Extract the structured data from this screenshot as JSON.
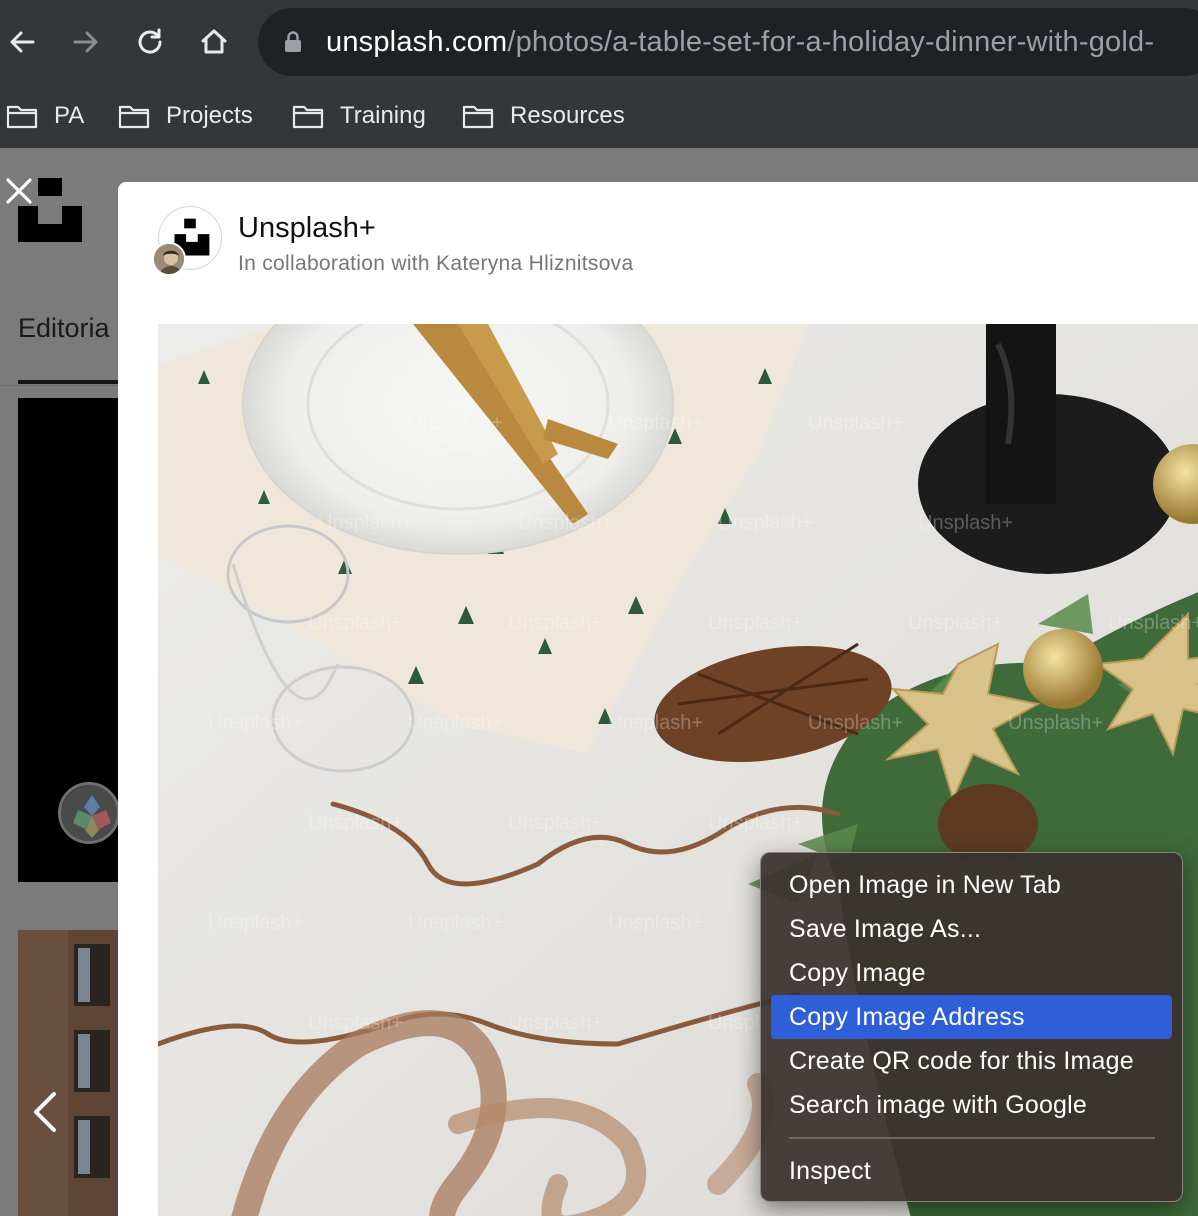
{
  "browser": {
    "url_host": "unsplash.com",
    "url_path": "/photos/a-table-set-for-a-holiday-dinner-with-gold-",
    "nav": [
      "back-icon",
      "forward-icon",
      "reload-icon",
      "home-icon"
    ],
    "bookmarks": [
      "PA",
      "Projects",
      "Training",
      "Resources"
    ]
  },
  "background_page": {
    "tab_label": "Editoria"
  },
  "modal": {
    "author_name": "Unsplash+",
    "collaboration": "In collaboration with Kateryna Hliznitsova",
    "watermark_text": "Unsplash+"
  },
  "context_menu": {
    "items": [
      "Open Image in New Tab",
      "Save Image As...",
      "Copy Image",
      "Copy Image Address",
      "Create QR code for this Image",
      "Search image with Google",
      "Inspect"
    ],
    "highlighted": "Copy Image Address"
  },
  "colors": {
    "chrome_bg": "#35363a",
    "omnibox_bg": "#202124",
    "menu_highlight": "#2f5fd6"
  }
}
